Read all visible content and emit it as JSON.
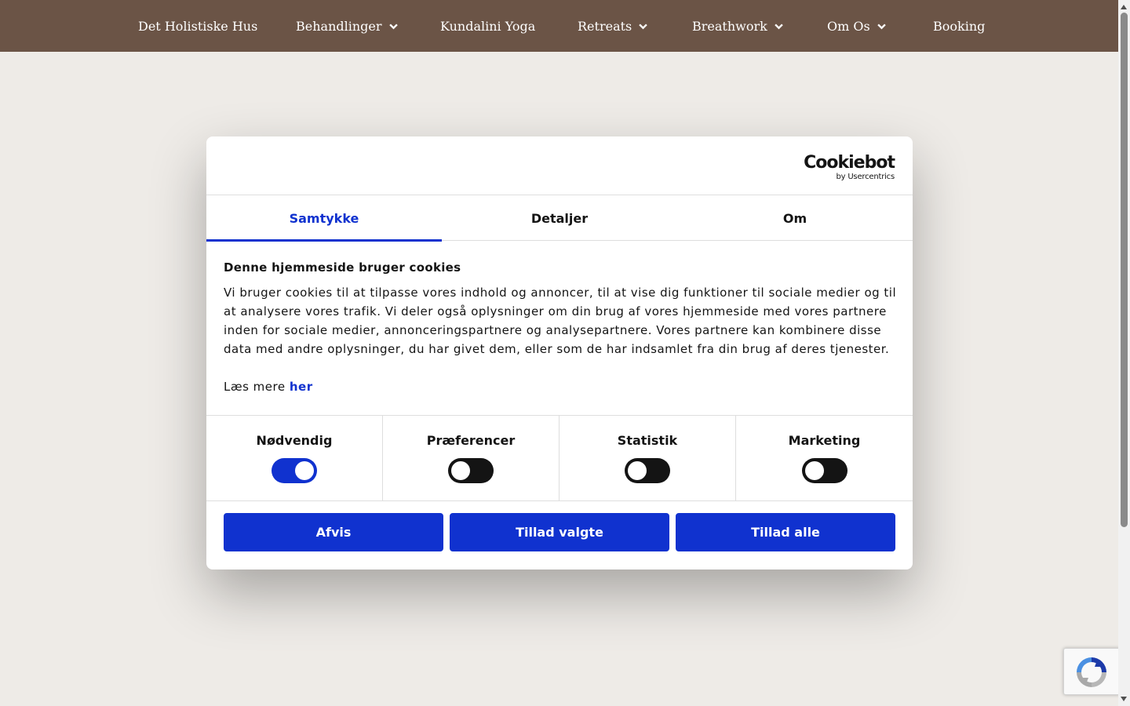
{
  "nav": {
    "items": [
      {
        "label": "Det Holistiske Hus",
        "dropdown": false
      },
      {
        "label": "Behandlinger",
        "dropdown": true
      },
      {
        "label": "Kundalini Yoga",
        "dropdown": false
      },
      {
        "label": "Retreats",
        "dropdown": true
      },
      {
        "label": "Breathwork",
        "dropdown": true
      },
      {
        "label": "Om Os",
        "dropdown": true
      },
      {
        "label": "Booking",
        "dropdown": false
      }
    ]
  },
  "colors": {
    "nav_bg": "#6b5446",
    "page_bg": "#eeebe7",
    "accent": "#1032cf",
    "toggle_off": "#141414"
  },
  "cookie": {
    "logo_main": "Cookiebot",
    "logo_sub": "by Usercentrics",
    "tabs": [
      "Samtykke",
      "Detaljer",
      "Om"
    ],
    "active_tab": "Samtykke",
    "heading": "Denne hjemmeside bruger cookies",
    "text": "Vi bruger cookies til at tilpasse vores indhold og annoncer, til at vise dig funktioner til sociale medier og til at analysere vores trafik. Vi deler også oplysninger om din brug af vores hjemmeside med vores partnere inden for sociale medier, annonceringspartnere og analysepartnere. Vores partnere kan kombinere disse data med andre oplysninger, du har givet dem, eller som de har indsamlet fra din brug af deres tjenester.",
    "read_more_prefix": "Læs mere",
    "read_more_link": "her",
    "categories": [
      {
        "label": "Nødvendig",
        "checked": true
      },
      {
        "label": "Præferencer",
        "checked": false
      },
      {
        "label": "Statistik",
        "checked": false
      },
      {
        "label": "Marketing",
        "checked": false
      }
    ],
    "buttons": {
      "deny": "Afvis",
      "allow_selected": "Tillad valgte",
      "allow_all": "Tillad alle"
    }
  },
  "recaptcha": {
    "icon": "recaptcha-icon"
  }
}
